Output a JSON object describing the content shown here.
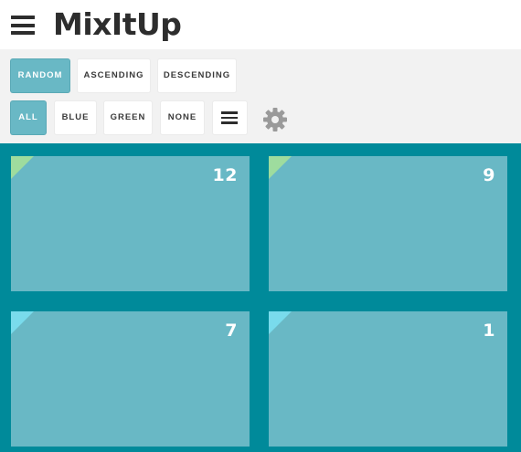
{
  "header": {
    "logo_text": "MixItUp"
  },
  "sort_buttons": [
    {
      "label": "RANDOM",
      "active": true
    },
    {
      "label": "ASCENDING",
      "active": false
    },
    {
      "label": "DESCENDING",
      "active": false
    }
  ],
  "filter_buttons": [
    {
      "label": "ALL",
      "active": true
    },
    {
      "label": "BLUE",
      "active": false
    },
    {
      "label": "GREEN",
      "active": false
    },
    {
      "label": "NONE",
      "active": false
    }
  ],
  "icons": {
    "menu": "hamburger-icon",
    "layout": "list-layout-icon",
    "settings": "gear-icon"
  },
  "cards": [
    {
      "number": "12",
      "tag": "green"
    },
    {
      "number": "9",
      "tag": "green"
    },
    {
      "number": "7",
      "tag": "blue"
    },
    {
      "number": "1",
      "tag": "blue"
    }
  ],
  "colors": {
    "accent": "#69b8c5",
    "grid_bg": "#008a9a",
    "green_tag": "#9edc9e",
    "blue_tag": "#79dbec",
    "text_dark": "#2d2d2d"
  }
}
